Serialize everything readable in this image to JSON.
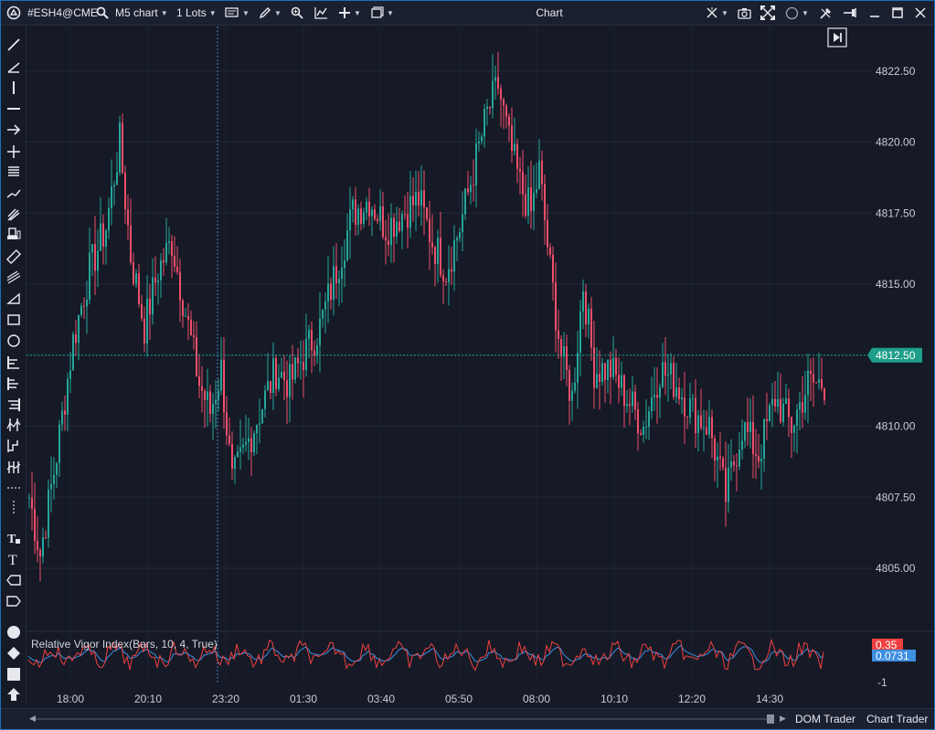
{
  "toolbar": {
    "symbol": "#ESH4@CME",
    "chart_type": "M5 chart",
    "lots": "1 Lots"
  },
  "window": {
    "title": "Chart"
  },
  "indicator": {
    "label": "Relative Vigor Index(Bars, 10, 4, True)",
    "value_red": "0.35",
    "value_blue": "0.0731",
    "axis_min": "-1"
  },
  "price_label": "4812.50",
  "statusbar": {
    "dom_trader": "DOM Trader",
    "chart_trader": "Chart Trader"
  },
  "colors": {
    "up": "#26a69a",
    "down": "#ef4f6a",
    "background": "#151a26",
    "price_line": "#1f9e8a",
    "rvi_red": "#ef4040",
    "rvi_blue": "#3d8fe0"
  },
  "chart_data": {
    "type": "candlestick",
    "symbol": "#ESH4@CME",
    "timeframe": "M5",
    "x_tick_labels": [
      "18:00",
      "20:10",
      "23:20",
      "01:30",
      "03:40",
      "05:50",
      "08:00",
      "10:10",
      "12:20",
      "14:30"
    ],
    "y_tick_labels": [
      "4822.50",
      "4820.00",
      "4817.50",
      "4815.00",
      "4812.50",
      "4810.00",
      "4807.50",
      "4805.00"
    ],
    "ylim": [
      4804.0,
      4823.5
    ],
    "current_price": 4812.5,
    "price_path": [
      [
        0,
        4807.5
      ],
      [
        4,
        4805.5
      ],
      [
        10,
        4809.0
      ],
      [
        16,
        4813.0
      ],
      [
        22,
        4815.5
      ],
      [
        28,
        4817.0
      ],
      [
        33,
        4820.0
      ],
      [
        37,
        4816.0
      ],
      [
        42,
        4813.5
      ],
      [
        47,
        4815.5
      ],
      [
        52,
        4816.5
      ],
      [
        57,
        4814.0
      ],
      [
        62,
        4811.5
      ],
      [
        66,
        4810.5
      ],
      [
        70,
        4812.0
      ],
      [
        74,
        4808.0
      ],
      [
        78,
        4809.0
      ],
      [
        84,
        4810.5
      ],
      [
        90,
        4812.0
      ],
      [
        95,
        4811.5
      ],
      [
        100,
        4812.5
      ],
      [
        106,
        4813.5
      ],
      [
        112,
        4815.5
      ],
      [
        118,
        4817.5
      ],
      [
        124,
        4818.0
      ],
      [
        130,
        4817.0
      ],
      [
        136,
        4817.5
      ],
      [
        142,
        4818.0
      ],
      [
        147,
        4816.5
      ],
      [
        152,
        4815.5
      ],
      [
        157,
        4817.0
      ],
      [
        162,
        4819.0
      ],
      [
        167,
        4821.0
      ],
      [
        171,
        4822.0
      ],
      [
        175,
        4820.0
      ],
      [
        179,
        4818.5
      ],
      [
        183,
        4817.5
      ],
      [
        186,
        4819.0
      ],
      [
        190,
        4815.5
      ],
      [
        194,
        4812.5
      ],
      [
        198,
        4811.0
      ],
      [
        202,
        4815.0
      ],
      [
        206,
        4812.0
      ],
      [
        212,
        4812.0
      ],
      [
        218,
        4811.0
      ],
      [
        224,
        4810.0
      ],
      [
        230,
        4812.0
      ],
      [
        236,
        4811.5
      ],
      [
        242,
        4810.5
      ],
      [
        248,
        4810.0
      ],
      [
        254,
        4807.5
      ],
      [
        260,
        4810.0
      ],
      [
        266,
        4809.0
      ],
      [
        272,
        4811.0
      ],
      [
        278,
        4810.0
      ],
      [
        284,
        4811.5
      ],
      [
        290,
        4811.5
      ]
    ],
    "rvi": {
      "name": "Relative Vigor Index(Bars, 10, 4, True)",
      "last_red": 0.35,
      "last_blue": 0.0731,
      "axis_label": "-1"
    }
  }
}
